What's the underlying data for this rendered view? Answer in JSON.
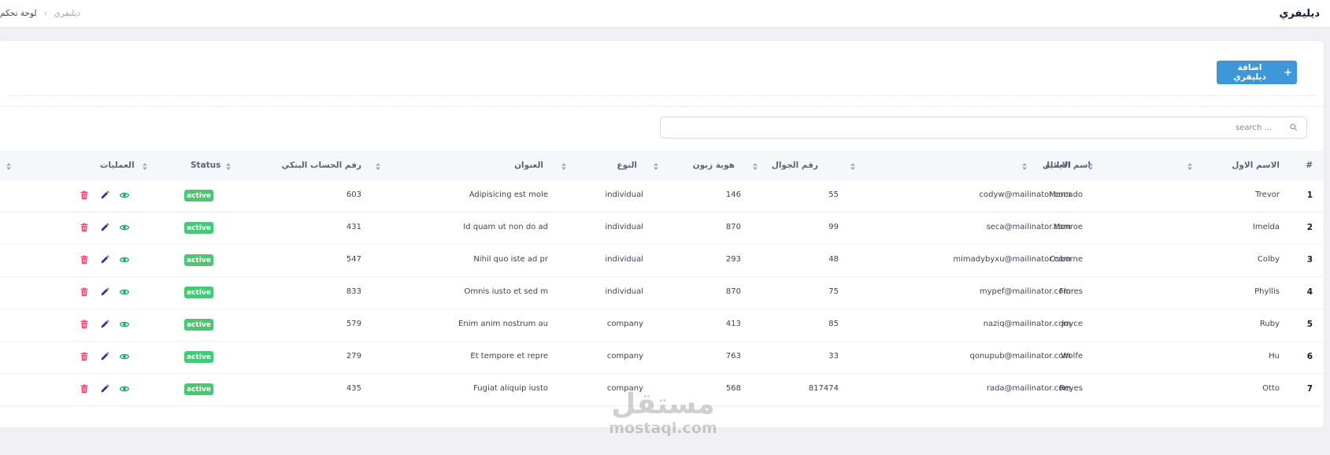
{
  "header": {
    "title": "ديليفري",
    "breadcrumb": {
      "home": "لوحة تحكم",
      "separator": "‹",
      "current": "ديليفري"
    }
  },
  "toolbar": {
    "add_label": "اضافة ديليفري",
    "add_icon": "+"
  },
  "search": {
    "placeholder": "... search"
  },
  "table": {
    "columns": {
      "index": "#",
      "first_name": "الاسم الاول",
      "family_name": "اسم العائلة",
      "email": "الايميل",
      "mobile": "رقم الجوال",
      "customer_id": "هوية زبون",
      "type": "النوع",
      "address": "العنوان",
      "bank_account": "رقم الحساب البنكي",
      "status": "Status",
      "operations": "العمليات"
    },
    "rows": [
      {
        "index": "1",
        "first_name": "Trevor",
        "family_name": "Mercado",
        "email": "codyw@mailinator.com",
        "mobile": "55",
        "customer_id": "146",
        "type": "individual",
        "address": "Adipisicing est mole",
        "bank_account": "603",
        "status": "active"
      },
      {
        "index": "2",
        "first_name": "Imelda",
        "family_name": "Monroe",
        "email": "seca@mailinator.com",
        "mobile": "99",
        "customer_id": "870",
        "type": "individual",
        "address": "Id quam ut non do ad",
        "bank_account": "431",
        "status": "active"
      },
      {
        "index": "3",
        "first_name": "Colby",
        "family_name": "Osborne",
        "email": "mimadybyxu@mailinator.com",
        "mobile": "48",
        "customer_id": "293",
        "type": "individual",
        "address": "Nihil quo iste ad pr",
        "bank_account": "547",
        "status": "active"
      },
      {
        "index": "4",
        "first_name": "Phyllis",
        "family_name": "Flores",
        "email": "mypef@mailinator.com",
        "mobile": "75",
        "customer_id": "870",
        "type": "individual",
        "address": "Omnis iusto et sed m",
        "bank_account": "833",
        "status": "active"
      },
      {
        "index": "5",
        "first_name": "Ruby",
        "family_name": "Joyce",
        "email": "naziq@mailinator.com",
        "mobile": "85",
        "customer_id": "413",
        "type": "company",
        "address": "Enim anim nostrum au",
        "bank_account": "579",
        "status": "active"
      },
      {
        "index": "6",
        "first_name": "Hu",
        "family_name": "Wolfe",
        "email": "qonupub@mailinator.com",
        "mobile": "33",
        "customer_id": "763",
        "type": "company",
        "address": "Et tempore et repre",
        "bank_account": "279",
        "status": "active"
      },
      {
        "index": "7",
        "first_name": "Otto",
        "family_name": "Reyes",
        "email": "rada@mailinator.com",
        "mobile": "817474",
        "customer_id": "568",
        "type": "company",
        "address": "Fugiat aliquip iusto",
        "bank_account": "435",
        "status": "active"
      }
    ]
  },
  "watermark": {
    "arabic": "مستقل",
    "latin": "mostaql.com"
  },
  "colors": {
    "primary": "#3e97d8",
    "success": "#48c774",
    "danger": "#f1416c",
    "edit": "#2d3a8c",
    "view": "#17a673"
  },
  "icons": {
    "search": "search-icon",
    "sort": "sort-icon",
    "view": "eye-icon",
    "edit": "pencil-icon",
    "delete": "trash-icon"
  }
}
